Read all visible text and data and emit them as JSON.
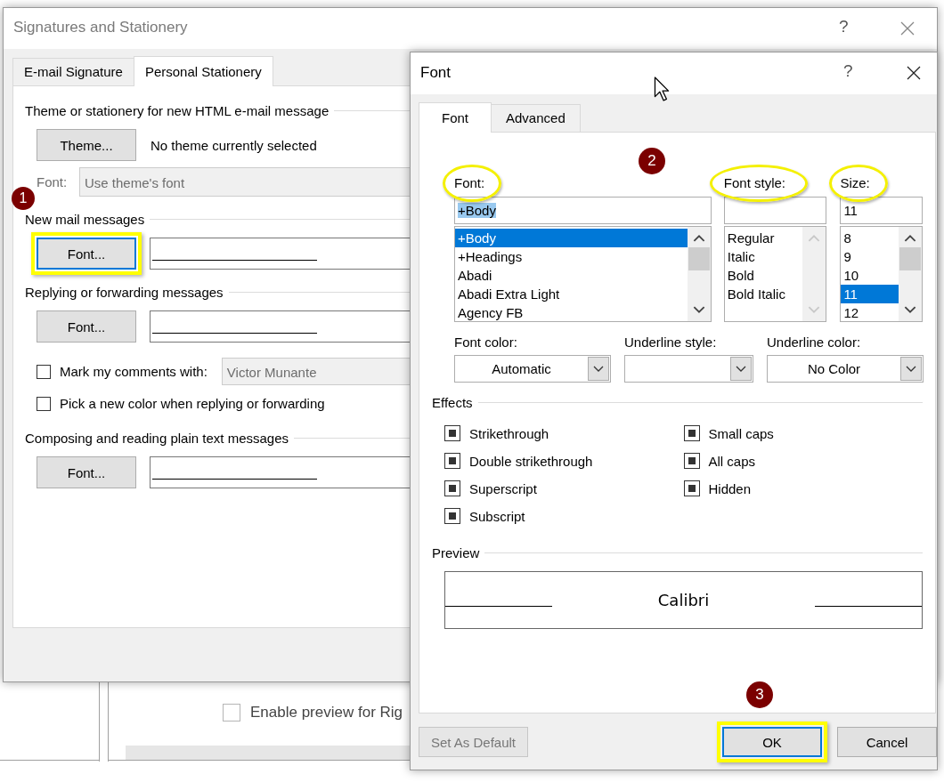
{
  "background_window": {
    "checkboxes": [
      {
        "label": "Enable preview for Rig",
        "checked": false
      }
    ]
  },
  "signatures_dialog": {
    "title": "Signatures and Stationery",
    "help": "?",
    "tabs": [
      {
        "label": "E-mail Signature",
        "selected": false
      },
      {
        "label": "Personal Stationery",
        "selected": true
      }
    ],
    "theme_section": {
      "heading": "Theme or stationery for new HTML e-mail message",
      "button": "Theme...",
      "status": "No theme currently selected",
      "font_label": "Font:",
      "font_value": "Use theme's font"
    },
    "font_sections": [
      {
        "heading": "New mail messages",
        "button": "Font...",
        "highlighted": true,
        "badge": "1"
      },
      {
        "heading": "Replying or forwarding messages",
        "button": "Font...",
        "options": [
          {
            "kind": "checkbox-field",
            "label": "Mark my comments with:",
            "checked": false,
            "value": "Victor Munante"
          },
          {
            "kind": "checkbox",
            "label": "Pick a new color when replying or forwarding",
            "checked": false
          }
        ]
      },
      {
        "heading": "Composing and reading plain text messages",
        "button": "Font..."
      }
    ]
  },
  "font_dialog": {
    "title": "Font",
    "help": "?",
    "tabs": [
      {
        "label": "Font",
        "selected": true
      },
      {
        "label": "Advanced",
        "selected": false
      }
    ],
    "badge": "2",
    "lists": [
      {
        "label": "Font:",
        "highlighted": true,
        "value": "+Body",
        "scroll_enabled": true,
        "items": [
          {
            "label": "+Body",
            "selected": true
          },
          {
            "label": "+Headings",
            "selected": false
          },
          {
            "label": "Abadi",
            "selected": false
          },
          {
            "label": "Abadi Extra Light",
            "selected": false
          },
          {
            "label": "Agency FB",
            "selected": false
          }
        ]
      },
      {
        "label": "Font style:",
        "highlighted": true,
        "scroll_enabled": false,
        "items": [
          {
            "label": "Regular",
            "selected": false
          },
          {
            "label": "Italic",
            "selected": false
          },
          {
            "label": "Bold",
            "selected": false
          },
          {
            "label": "Bold Italic",
            "selected": false
          }
        ]
      },
      {
        "label": "Size:",
        "highlighted": true,
        "value": "11",
        "scroll_enabled": true,
        "items": [
          {
            "label": "8",
            "selected": false
          },
          {
            "label": "9",
            "selected": false
          },
          {
            "label": "10",
            "selected": false
          },
          {
            "label": "11",
            "selected": true
          },
          {
            "label": "12",
            "selected": false
          }
        ]
      }
    ],
    "dropdowns": [
      {
        "label": "Font color:",
        "value": "Automatic"
      },
      {
        "label": "Underline style:"
      },
      {
        "label": "Underline color:",
        "value": "No Color"
      }
    ],
    "effects": {
      "heading": "Effects",
      "columns": [
        [
          {
            "label": "Strikethrough",
            "indeterminate": true
          },
          {
            "label": "Double strikethrough",
            "indeterminate": true
          },
          {
            "label": "Superscript",
            "indeterminate": true
          },
          {
            "label": "Subscript",
            "indeterminate": true
          }
        ],
        [
          {
            "label": "Small caps",
            "indeterminate": true
          },
          {
            "label": "All caps",
            "indeterminate": true
          },
          {
            "label": "Hidden",
            "indeterminate": true
          }
        ]
      ]
    },
    "preview": {
      "heading": "Preview",
      "sample": "Calibri"
    },
    "footer_badge": "3",
    "buttons": [
      {
        "label": "Set As Default",
        "disabled": true
      },
      {
        "label": "OK",
        "disabled": false,
        "highlighted": true
      },
      {
        "label": "Cancel",
        "disabled": false
      }
    ]
  }
}
